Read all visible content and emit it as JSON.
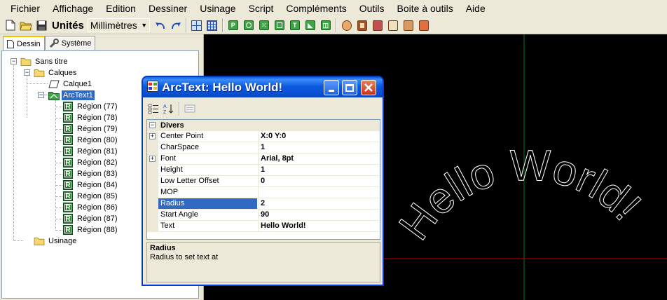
{
  "menu": [
    "Fichier",
    "Affichage",
    "Edition",
    "Dessiner",
    "Usinage",
    "Script",
    "Compléments",
    "Outils",
    "Boite à outils",
    "Aide"
  ],
  "toolbar": {
    "units_label": "Unités",
    "units_value": "Millimètres"
  },
  "tabs": [
    "Dessin",
    "Système"
  ],
  "tree": {
    "root": "Sans titre",
    "calques": "Calques",
    "calque1": "Calque1",
    "arctext": "ArcText1",
    "regions": [
      "Région (77)",
      "Région (78)",
      "Région (79)",
      "Région (80)",
      "Région (81)",
      "Région (82)",
      "Région (83)",
      "Région (84)",
      "Région (85)",
      "Région (86)",
      "Région (87)",
      "Région (88)"
    ],
    "usinage": "Usinage"
  },
  "dialog": {
    "title": "ArcText: Hello World!",
    "category": "Divers",
    "properties": [
      {
        "name": "Center Point",
        "value": "X:0 Y:0",
        "expandable": true,
        "selected": false
      },
      {
        "name": "CharSpace",
        "value": "1",
        "expandable": false,
        "selected": false
      },
      {
        "name": "Font",
        "value": "Arial, 8pt",
        "expandable": true,
        "selected": false
      },
      {
        "name": "Height",
        "value": "1",
        "expandable": false,
        "selected": false
      },
      {
        "name": "Low Letter Offset",
        "value": "0",
        "expandable": false,
        "selected": false
      },
      {
        "name": "MOP",
        "value": "",
        "expandable": false,
        "selected": false
      },
      {
        "name": "Radius",
        "value": "2",
        "expandable": false,
        "selected": true
      },
      {
        "name": "Start Angle",
        "value": "90",
        "expandable": false,
        "selected": false
      },
      {
        "name": "Text",
        "value": "Hello World!",
        "expandable": false,
        "selected": false
      }
    ],
    "description_title": "Radius",
    "description_text": "Radius to set text at"
  },
  "canvas": {
    "text": "Hello World!",
    "background": "#000000",
    "x_axis_color": "#c00000",
    "y_axis_color": "#007a2a",
    "text_color": "#ffffff"
  }
}
